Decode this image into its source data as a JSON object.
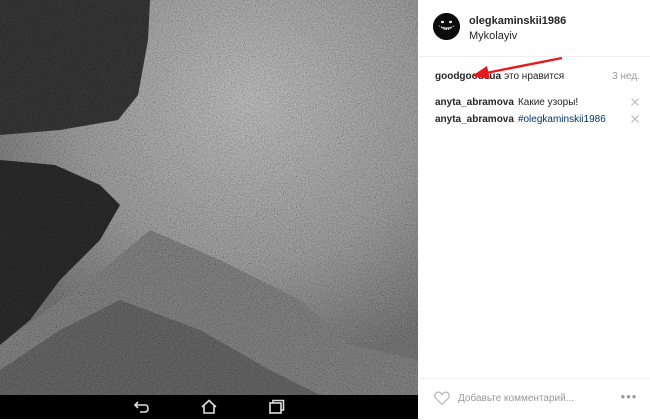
{
  "post": {
    "username": "olegkaminskii1986",
    "location": "Mykolayiv"
  },
  "likes": {
    "liker": "goodgoodsua",
    "text": "это нравится",
    "time": "3 нед."
  },
  "comments": [
    {
      "author": "anyta_abramova",
      "text": "Какие узоры!",
      "hashtag": ""
    },
    {
      "author": "anyta_abramova",
      "text": "",
      "hashtag": "#olegkaminskii1986"
    }
  ],
  "footer": {
    "comment_placeholder": "Добавьте комментарий...",
    "more": "•••"
  },
  "colors": {
    "link": "#003569",
    "muted": "#999999",
    "text": "#262626",
    "arrow": "#e8181c"
  },
  "icons": {
    "back": "back-icon",
    "home": "home-icon",
    "recent": "recent-apps-icon",
    "heart": "heart-icon",
    "delete": "close-icon"
  }
}
